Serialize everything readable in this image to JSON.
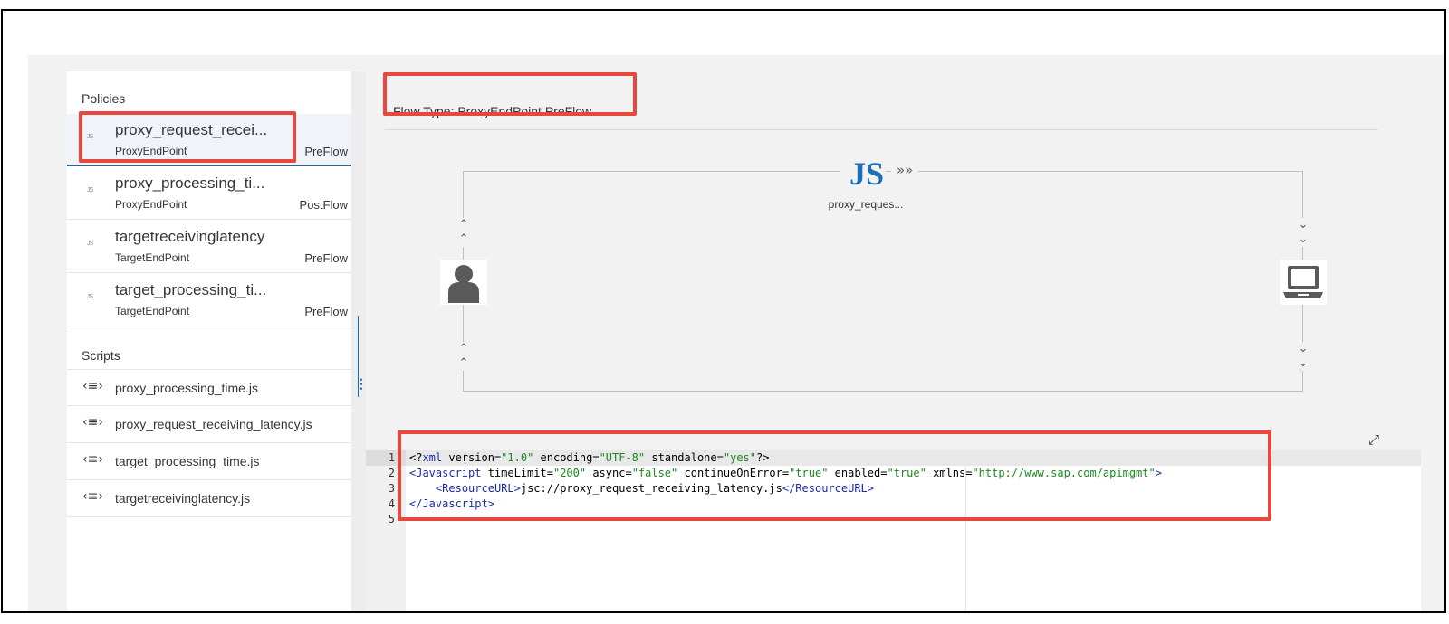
{
  "sidebar": {
    "policies_title": "Policies",
    "policies": [
      {
        "name": "proxy_request_recei...",
        "endpoint": "ProxyEndPoint",
        "flow": "PreFlow",
        "selected": true
      },
      {
        "name": "proxy_processing_ti...",
        "endpoint": "ProxyEndPoint",
        "flow": "PostFlow"
      },
      {
        "name": "targetreceivinglatency",
        "endpoint": "TargetEndPoint",
        "flow": "PreFlow"
      },
      {
        "name": "target_processing_ti...",
        "endpoint": "TargetEndPoint",
        "flow": "PreFlow"
      }
    ],
    "scripts_title": "Scripts",
    "scripts": [
      {
        "name": "proxy_processing_time.js"
      },
      {
        "name": "proxy_request_receiving_latency.js"
      },
      {
        "name": "target_processing_time.js"
      },
      {
        "name": "targetreceivinglatency.js"
      }
    ]
  },
  "main": {
    "flow_type": "Flow Type: ProxyEndPoint PreFlow",
    "diagram": {
      "policy_icon": "JS",
      "policy_name": "proxy_reques...",
      "left_actor_icon": "user-icon",
      "right_actor_icon": "laptop-icon"
    }
  },
  "editor": {
    "line_numbers": [
      "1",
      "2",
      "3",
      "4",
      "5"
    ],
    "lines": {
      "l1": {
        "a": "<?",
        "b": "xml",
        "c": " version",
        "d": "=",
        "e": "\"1.0\"",
        "f": " encoding",
        "g": "=",
        "h": "\"UTF-8\"",
        "i": " standalone",
        "j": "=",
        "k": "\"yes\"",
        "l": "?>"
      },
      "l2": {
        "a": "<",
        "b": "Javascript",
        "c": " timeLimit",
        "d": "=",
        "e": "\"200\"",
        "f": " async",
        "g": "=",
        "h": "\"false\"",
        "i": " continueOnError",
        "j": "=",
        "k": "\"true\"",
        "l": " enabled",
        "m": "=",
        "n": "\"true\"",
        "o": " xmlns",
        "p": "=",
        "q": "\"http://www.sap.com/apimgmt\"",
        "r": ">"
      },
      "l3": {
        "indent": "    ",
        "a": "<",
        "b": "ResourceURL",
        "c": ">",
        "d": "jsc://proxy_request_receiving_latency.js",
        "e": "</",
        "f": "ResourceURL",
        "g": ">"
      },
      "l4": {
        "a": "</",
        "b": "Javascript",
        "c": ">"
      },
      "l5": ""
    }
  },
  "colors": {
    "highlight": "#e8473d",
    "accent": "#0a6ed1",
    "js_blue": "#1a6fb5"
  }
}
